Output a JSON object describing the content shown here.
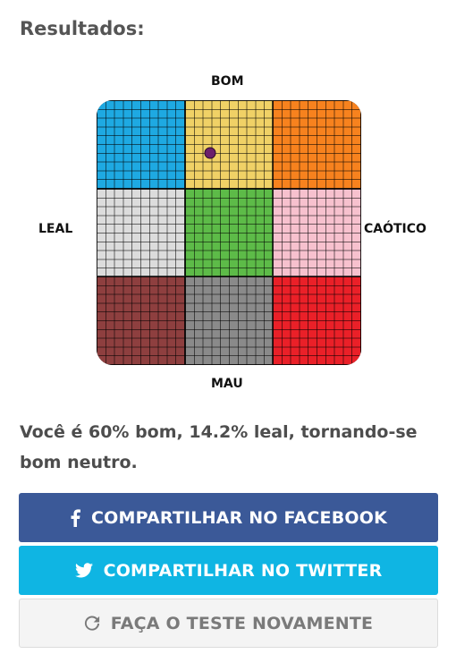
{
  "header": {
    "title": "Resultados:"
  },
  "chart": {
    "axis_top": "BOM",
    "axis_bottom": "MAU",
    "axis_left": "LEAL",
    "axis_right": "CAÓTICO",
    "cells": [
      {
        "name": "leal-bom",
        "color": "#1ea9e2"
      },
      {
        "name": "neutro-bom",
        "color": "#f0d166"
      },
      {
        "name": "caotico-bom",
        "color": "#f7821e"
      },
      {
        "name": "leal-neutro",
        "color": "#dcdcdc"
      },
      {
        "name": "neutro",
        "color": "#5dbb48"
      },
      {
        "name": "caotico-neutro",
        "color": "#f7c1ce"
      },
      {
        "name": "leal-mau",
        "color": "#8e3f3f"
      },
      {
        "name": "neutro-mau",
        "color": "#8a8a8a"
      },
      {
        "name": "caotico-mau",
        "color": "#ea2028"
      }
    ],
    "marker": {
      "good_percent": 60,
      "lawful_percent": 14.2,
      "color": "#6b1f6b"
    }
  },
  "result_text": "Você é 60% bom, 14.2% leal, tornando-se bom neutro.",
  "buttons": {
    "facebook": {
      "label": "COMPARTILHAR NO FACEBOOK",
      "icon": "facebook-icon",
      "color": "#3b5998"
    },
    "twitter": {
      "label": "COMPARTILHAR NO TWITTER",
      "icon": "twitter-icon",
      "color": "#0fb5e3"
    },
    "retake": {
      "label": "FAÇA O TESTE NOVAMENTE",
      "icon": "refresh-icon",
      "color": "#f4f4f4"
    }
  }
}
